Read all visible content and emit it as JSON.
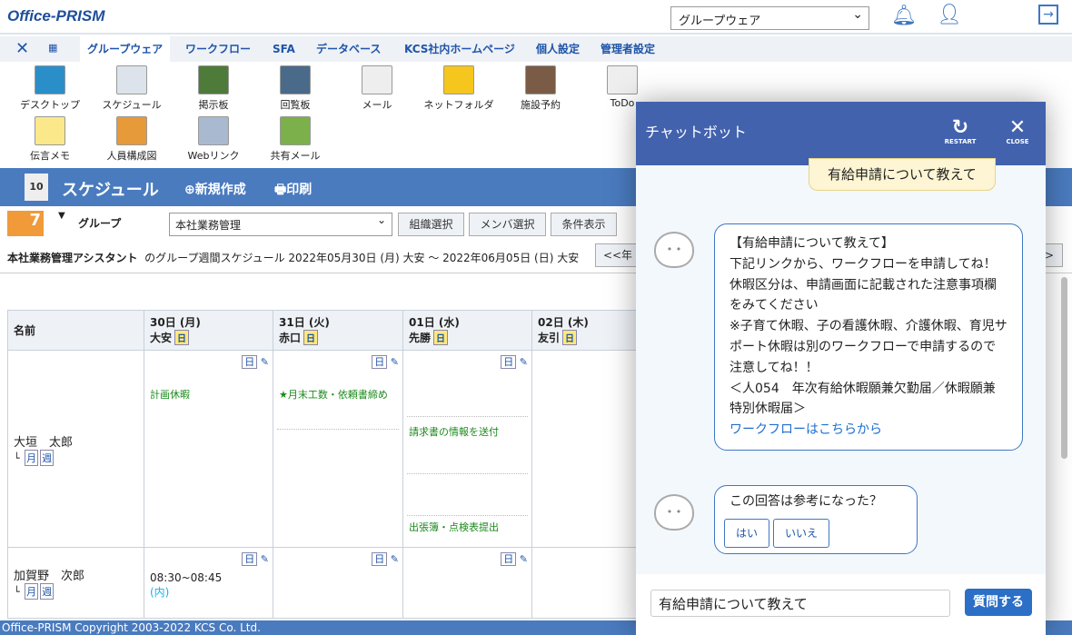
{
  "header": {
    "logo": "Office-PRISM",
    "app_select": "グループウェア"
  },
  "nav": {
    "tabs": [
      "グループウェア",
      "ワークフロー",
      "SFA",
      "データベース",
      "KCS社内ホームページ",
      "個人設定",
      "管理者設定"
    ]
  },
  "apps": [
    {
      "label": "デスクトップ",
      "color": "#2a8fc8"
    },
    {
      "label": "スケジュール",
      "color": "#dde3ea"
    },
    {
      "label": "掲示板",
      "color": "#4e7a3a"
    },
    {
      "label": "回覧板",
      "color": "#4a6a8a"
    },
    {
      "label": "メール",
      "color": "#eeeeee"
    },
    {
      "label": "ネットフォルダ",
      "color": "#f5c61e"
    },
    {
      "label": "施設予約",
      "color": "#7a5c46"
    },
    {
      "label": "ToDo",
      "color": "#eeeeee"
    },
    {
      "label": "伝言メモ",
      "color": "#fbe88a"
    },
    {
      "label": "人員構成図",
      "color": "#e79a3a"
    },
    {
      "label": "Webリンク",
      "color": "#a9b9cf"
    },
    {
      "label": "共有メール",
      "color": "#7bb04a"
    }
  ],
  "schedule": {
    "title": "スケジュール",
    "new": "新規作成",
    "print": "印刷",
    "group_label": "グループ",
    "group_select": "本社業務管理",
    "buttons": [
      "組織選択",
      "メンバ選択",
      "条件表示"
    ],
    "owner": "本社業務管理アシスタント",
    "range": "のグループ週間スケジュール 2022年05月30日 (月) 大安 ～ 2022年06月05日 (日) 大安",
    "prev": "<<年",
    "next": ">"
  },
  "table": {
    "name_header": "名前",
    "days": [
      {
        "date": "30日 (月)",
        "rokuyo": "大安"
      },
      {
        "date": "31日 (火)",
        "rokuyo": "赤口"
      },
      {
        "date": "01日 (水)",
        "rokuyo": "先勝"
      },
      {
        "date": "02日 (木)",
        "rokuyo": "友引"
      }
    ],
    "day_icon": "日",
    "month": "月",
    "week": "週",
    "rows": [
      {
        "name": "大垣　太郎",
        "events": [
          [
            "計画休暇"
          ],
          [
            "★月末工数・依頼書締め"
          ],
          [
            "請求書の情報を送付",
            "出張簿・点検表提出"
          ],
          []
        ]
      },
      {
        "name": "加賀野　次郎",
        "time": "08:30~08:45",
        "place": "(内)"
      }
    ]
  },
  "chat": {
    "title": "チャットボット",
    "restart": "RESTART",
    "close": "CLOSE",
    "user_msg": "有給申請について教えて",
    "bot_msg": [
      "【有給申請について教えて】",
      "下記リンクから、ワークフローを申請してね！",
      "休暇区分は、申請画面に記載された注意事項欄をみてください",
      "※子育て休暇、子の看護休暇、介護休暇、育児サポート休暇は別のワークフローで申請するので注意してね！！",
      "＜人054　年次有給休暇願兼欠勤届／休暇願兼特別休暇届＞"
    ],
    "link": "ワークフローはこちらから",
    "feedback_q": "この回答は参考になった？",
    "yes": "はい",
    "no": "いいえ",
    "input_value": "有給申請について教えて",
    "send": "質問する"
  },
  "footer": "Office-PRISM Copyright 2003-2022 KCS Co. Ltd."
}
